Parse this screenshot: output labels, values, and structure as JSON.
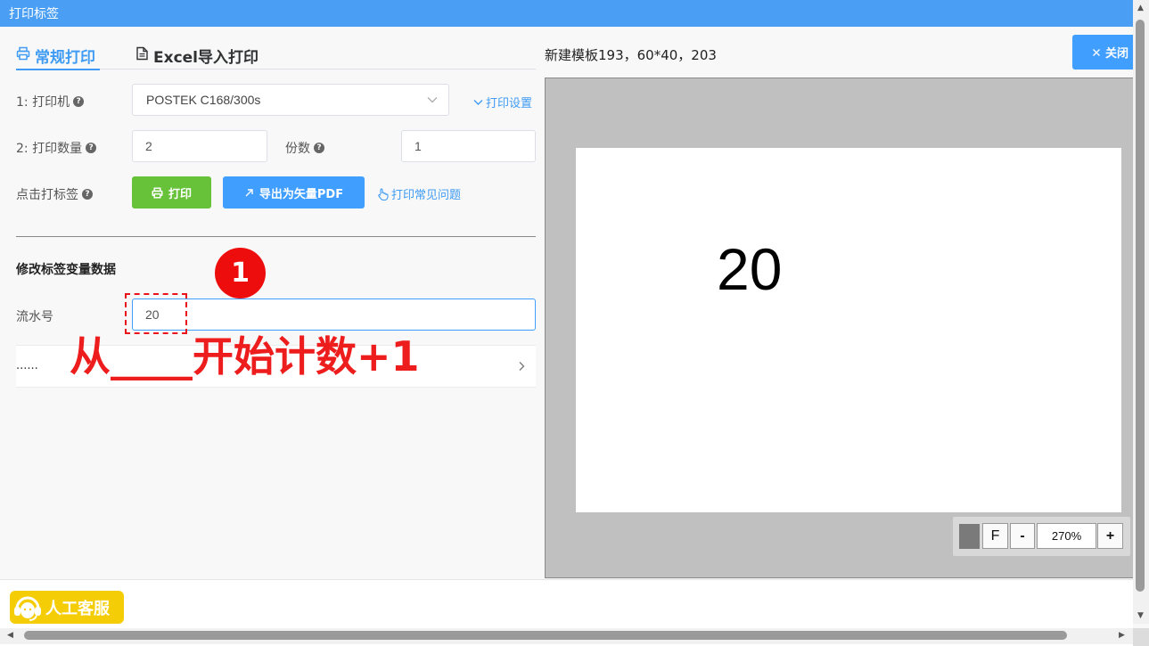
{
  "window": {
    "title": "打印标签"
  },
  "tabs": [
    {
      "label": "常规打印",
      "icon": "printer-icon",
      "active": true
    },
    {
      "label": "Excel导入打印",
      "icon": "document-icon",
      "active": false
    }
  ],
  "form": {
    "printer_label": "1: 打印机",
    "printer_value": "POSTEK C168/300s",
    "print_settings_link": "打印设置",
    "quantity_label": "2: 打印数量",
    "quantity_value": "2",
    "copies_label": "份数",
    "copies_value": "1",
    "click_print_label": "点击打标签",
    "print_button": "打印",
    "export_pdf_button": "导出为矢量PDF",
    "faq_link": "打印常见问题",
    "help_glyph": "?"
  },
  "variables": {
    "section_title": "修改标签变量数据",
    "serial_label": "流水号",
    "serial_value": "20",
    "more_row_label": "......"
  },
  "annotation": {
    "number": "1",
    "text": "从____开始计数+1",
    "color": "#ee1d1d"
  },
  "preview": {
    "template_name": "新建模板193，60*40，203",
    "close_button": "关闭",
    "label_text": "20",
    "zoom": {
      "fit_label": "F",
      "minus_label": "-",
      "zoom_value": "270%",
      "plus_label": "+"
    }
  },
  "footer": {
    "support_label": "人工客服",
    "support_color": "#f5cd07"
  },
  "colors": {
    "accent": "#409eff",
    "titlebar": "#4a9ff5",
    "print_green": "#67c23a"
  }
}
